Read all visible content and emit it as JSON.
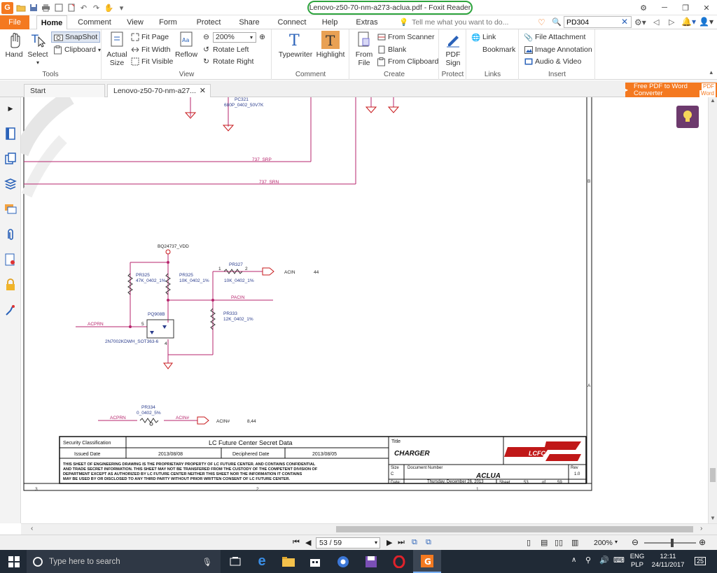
{
  "window": {
    "title": "Lenovo-z50-70-nm-a273-aclua.pdf - Foxit Reader",
    "app_logo": "G"
  },
  "ribbon_tabs": [
    "File",
    "Home",
    "Comment",
    "View",
    "Form",
    "Protect",
    "Share",
    "Connect",
    "Help",
    "Extras"
  ],
  "tell_me": "Tell me what you want to do...",
  "search": {
    "value": "PD304"
  },
  "ribbon": {
    "tools": {
      "label": "Tools",
      "hand": "Hand",
      "select": "Select",
      "snapshot": "SnapShot",
      "clipboard": "Clipboard"
    },
    "view": {
      "label": "View",
      "actual_size": "Actual Size",
      "fit_page": "Fit Page",
      "fit_width": "Fit Width",
      "fit_visible": "Fit Visible",
      "reflow": "Reflow",
      "zoom": "200%",
      "rotate_left": "Rotate Left",
      "rotate_right": "Rotate Right"
    },
    "comment": {
      "label": "Comment",
      "typewriter": "Typewriter",
      "highlight": "Highlight"
    },
    "create": {
      "label": "Create",
      "from_file": "From File",
      "from_scanner": "From Scanner",
      "blank": "Blank",
      "from_clipboard": "From Clipboard"
    },
    "protect": {
      "label": "Protect",
      "pdf_sign": "PDF Sign"
    },
    "links": {
      "label": "Links",
      "link": "Link",
      "bookmark": "Bookmark"
    },
    "insert": {
      "label": "Insert",
      "file_attachment": "File Attachment",
      "image_annotation": "Image Annotation",
      "audio_video": "Audio & Video"
    }
  },
  "doc_tabs": [
    {
      "label": "Start"
    },
    {
      "label": "Lenovo-z50-70-nm-a27..."
    }
  ],
  "promo": {
    "line1": "Free PDF to Word",
    "line2": "Converter",
    "badge1": "PDF",
    "badge2": "Word"
  },
  "schematic": {
    "top_labels": {
      "pc321": "PC321",
      "pc321_val": "680P_0402_50V7K",
      "srp": "737_SRP",
      "srn": "737_SRN"
    },
    "vdd": "BQ24737_VDD",
    "pr325a": "PR325",
    "pr325a_val": "47K_0402_1%",
    "pr325b": "PR325",
    "pr325b_val": "10K_0402_1%",
    "pr327": "PR327",
    "pr327_val": "10K_0402_1%",
    "acin": "ACIN",
    "acin_ref": "44",
    "pacin": "PACIN",
    "pr333": "PR333",
    "pr333_val": "12K_0402_1%",
    "pq908": "PQ908B",
    "pq908_val": "2N7002KDWH_SOT363-6",
    "acprn": "ACPRN",
    "pr334": "PR334",
    "pr334_val": "0_0402_5%",
    "acprn2": "ACPRN",
    "acin_hash": "ACIN#",
    "acin_hash2": "ACIN#",
    "acin_hash_ref": "8,44",
    "pin1": "1",
    "pin2": "2",
    "pin5": "5",
    "pin4": "4",
    "pin3": "3",
    "zone_b": "B",
    "zone_a": "A",
    "col3": "3",
    "col2": "2",
    "col1": "1"
  },
  "titleblock": {
    "security_label": "Security Classification",
    "security_value": "LC Future Center Secret Data",
    "issued_label": "Issued Date",
    "issued_value": "2013/08/08",
    "deciphered_label": "Deciphered Date",
    "deciphered_value": "2013/08/05",
    "notice1": "THIS SHEET OF ENGINEERING DRAWING IS THE PROPRIETARY PROPERTY OF  LC FUTURE CENTER. AND CONTAINS CONFIDENTIAL",
    "notice2": "AND TRADE SECRET INFORMATION. THIS SHEET MAY NOT BE TRANSFERED FROM THE CUSTODY OF THE COMPETENT DIVISION OF",
    "notice3": "DEPARTMENT EXCEPT AS AUTHORIZED BY LC FUTURE CENTER NEITHER THIS SHEET NOR THE INFORMATION IT CONTAINS",
    "notice4": "MAY BE USED BY OR DISCLOSED TO ANY THIRD PARTY WITHOUT PRIOR WRITTEN CONSENT OF  LC FUTURE CENTER.",
    "title_label": "Title",
    "title_value": "CHARGER",
    "logo_text": "LCFC",
    "size_label": "Size",
    "size_value": "C",
    "docnum_label": "Document Number",
    "docnum_value": "ACLUA",
    "rev_label": "Rev",
    "rev_value": "1.0",
    "date_label": "Date:",
    "date_value": "Thursday, December 26, 2013",
    "sheet_label": "Sheet",
    "sheet_value": "53",
    "of_label": "of",
    "of_value": "59"
  },
  "status": {
    "page": "53 / 59",
    "zoom": "200%"
  },
  "taskbar": {
    "search_placeholder": "Type here to search",
    "lang1": "ENG",
    "lang2": "PLP",
    "time": "12:11",
    "date": "24/11/2017",
    "notif": "25"
  }
}
